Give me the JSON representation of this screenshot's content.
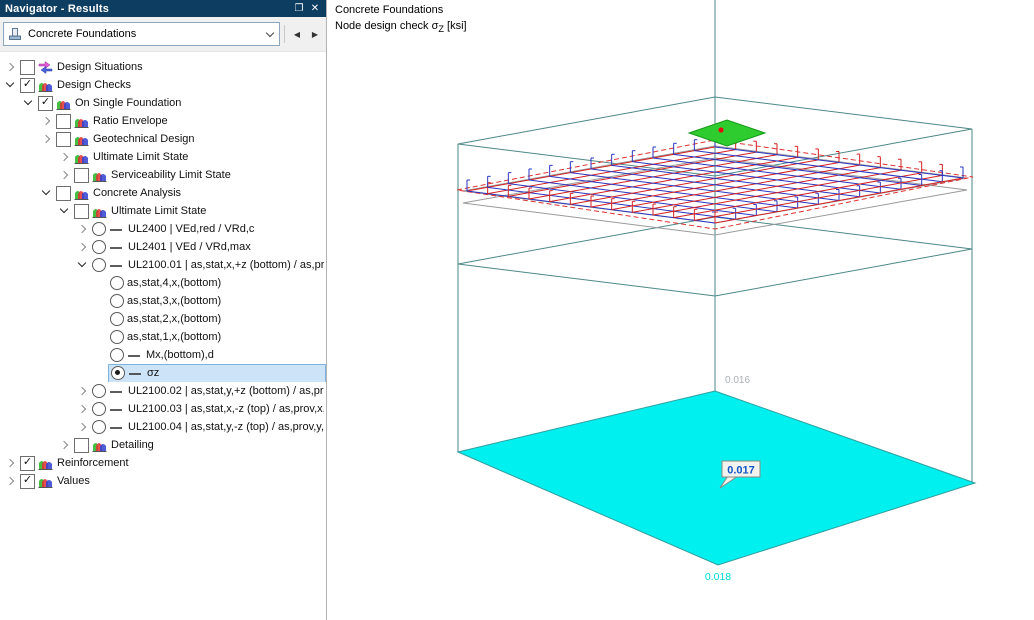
{
  "panel": {
    "title": "Navigator - Results",
    "float_icon": "❐",
    "close_icon": "✕",
    "check_glyph": "✓",
    "combo": {
      "value": "Concrete Foundations"
    },
    "nav": {
      "prev": "◀",
      "next": "▶"
    }
  },
  "viewport": {
    "title": "Concrete Foundations",
    "subtitle_pre": "Node design check σ",
    "subtitle_sub": "Z",
    "subtitle_post": " [ksi]",
    "labels": {
      "upper": "0.016",
      "tooltip": "0.017",
      "lower": "0.018"
    }
  },
  "tree": [
    {
      "depth": 0,
      "expander": "collapsed",
      "control": "checkbox-unchecked",
      "icon": "situations",
      "label": "Design Situations"
    },
    {
      "depth": 0,
      "expander": "expanded",
      "control": "checkbox-checked",
      "icon": "results",
      "label": "Design Checks"
    },
    {
      "depth": 1,
      "expander": "expanded",
      "control": "checkbox-checked",
      "icon": "results",
      "label": "On Single Foundation"
    },
    {
      "depth": 2,
      "expander": "collapsed",
      "control": "checkbox-unchecked",
      "icon": "results",
      "label": "Ratio Envelope"
    },
    {
      "depth": 2,
      "expander": "collapsed",
      "control": "checkbox-unchecked",
      "icon": "results",
      "label": "Geotechnical Design"
    },
    {
      "depth": 3,
      "expander": "collapsed",
      "control": "none",
      "icon": "results",
      "label": "Ultimate Limit State"
    },
    {
      "depth": 3,
      "expander": "collapsed",
      "control": "checkbox-unchecked",
      "icon": "results",
      "label": "Serviceability Limit State"
    },
    {
      "depth": 2,
      "expander": "expanded",
      "control": "checkbox-unchecked",
      "icon": "results",
      "label": "Concrete Analysis"
    },
    {
      "depth": 3,
      "expander": "expanded",
      "control": "checkbox-unchecked",
      "icon": "results",
      "label": "Ultimate Limit State"
    },
    {
      "depth": 4,
      "expander": "collapsed",
      "control": "radio",
      "icon": "dash",
      "label": "UL2400 | VEd,red / VRd,c"
    },
    {
      "depth": 4,
      "expander": "collapsed",
      "control": "radio",
      "icon": "dash",
      "label": "UL2401 | VEd / VRd,max"
    },
    {
      "depth": 4,
      "expander": "expanded",
      "control": "radio",
      "icon": "dash",
      "label": "UL2100.01 | as,stat,x,+z (bottom) / as,pr…"
    },
    {
      "depth": 5,
      "expander": "none",
      "control": "radio",
      "icon": "none",
      "label": "as,stat,4,x,(bottom)"
    },
    {
      "depth": 5,
      "expander": "none",
      "control": "radio",
      "icon": "none",
      "label": "as,stat,3,x,(bottom)"
    },
    {
      "depth": 5,
      "expander": "none",
      "control": "radio",
      "icon": "none",
      "label": "as,stat,2,x,(bottom)"
    },
    {
      "depth": 5,
      "expander": "none",
      "control": "radio",
      "icon": "none",
      "label": "as,stat,1,x,(bottom)"
    },
    {
      "depth": 5,
      "expander": "none",
      "control": "radio",
      "icon": "dash",
      "label": "Mx,(bottom),d"
    },
    {
      "depth": 5,
      "expander": "none",
      "control": "radio-selected",
      "icon": "dash",
      "label": "σz",
      "selected": true
    },
    {
      "depth": 4,
      "expander": "collapsed",
      "control": "radio",
      "icon": "dash",
      "label": "UL2100.02 | as,stat,y,+z (bottom) / as,pr…"
    },
    {
      "depth": 4,
      "expander": "collapsed",
      "control": "radio",
      "icon": "dash",
      "label": "UL2100.03 | as,stat,x,-z (top) / as,prov,x,-…"
    },
    {
      "depth": 4,
      "expander": "collapsed",
      "control": "radio",
      "icon": "dash",
      "label": "UL2100.04 | as,stat,y,-z (top) / as,prov,y,…"
    },
    {
      "depth": 3,
      "expander": "collapsed",
      "control": "checkbox-unchecked",
      "icon": "results",
      "label": "Detailing"
    },
    {
      "depth": 0,
      "expander": "collapsed",
      "control": "checkbox-checked",
      "icon": "results",
      "label": "Reinforcement"
    },
    {
      "depth": 0,
      "expander": "collapsed",
      "control": "checkbox-checked",
      "icon": "results",
      "label": "Values"
    }
  ]
}
